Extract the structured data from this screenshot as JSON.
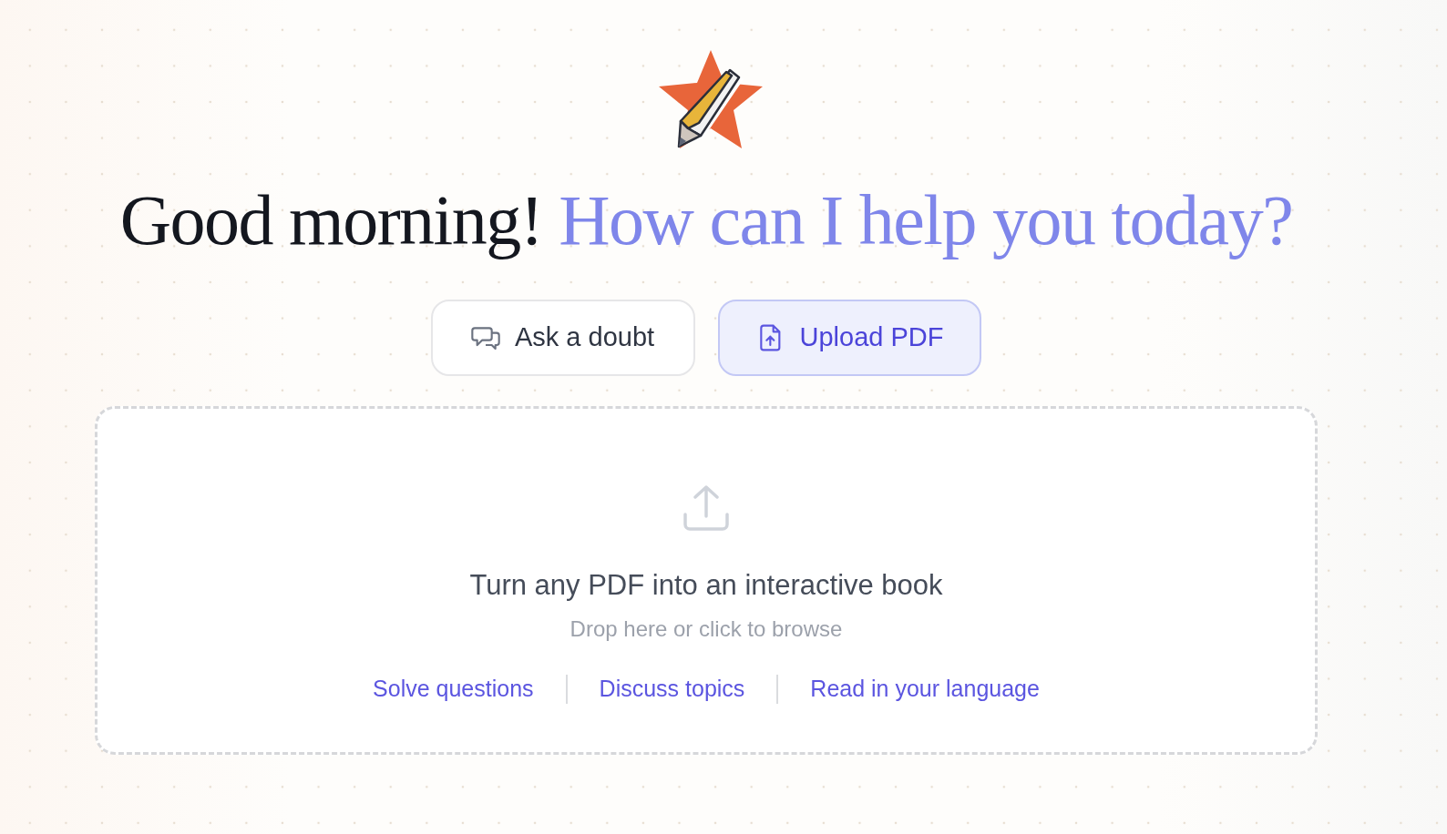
{
  "heading": {
    "greeting": "Good morning!",
    "prompt": "How can I help you today?"
  },
  "modes": [
    {
      "label": "Ask a doubt",
      "kind": "ask",
      "selected": false
    },
    {
      "label": "Upload PDF",
      "kind": "upload",
      "selected": true
    }
  ],
  "dropzone": {
    "title": "Turn any PDF into an interactive book",
    "hint": "Drop here or click to browse",
    "features": [
      "Solve questions",
      "Discuss topics",
      "Read in your language"
    ]
  }
}
